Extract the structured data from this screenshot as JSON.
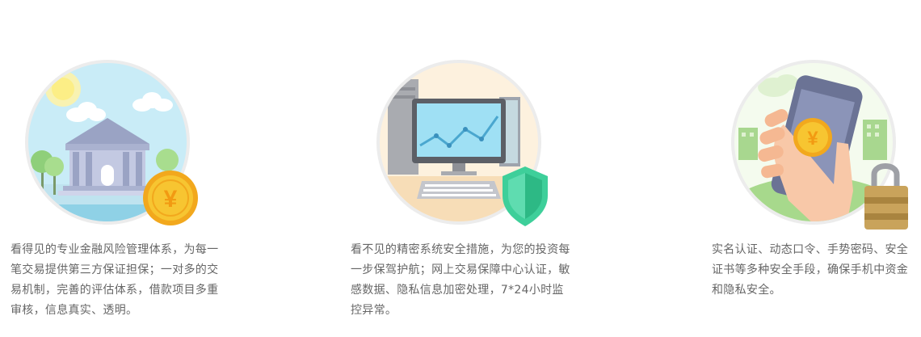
{
  "features": [
    {
      "icon": "bank-building-icon",
      "coin_symbol": "¥",
      "description": "看得见的专业金融风险管理体系，为每一笔交易提供第三方保证担保；一对多的交易机制，完善的评估体系，借款项目多重审核，信息真实、透明。"
    },
    {
      "icon": "computer-shield-icon",
      "description": "看不见的精密系统安全措施，为您的投资每一步保驾护航；网上交易保障中心认证，敏感数据、隐私信息加密处理，7*24小时监控异常。"
    },
    {
      "icon": "phone-lock-icon",
      "coin_symbol": "¥",
      "description": "实名认证、动态口令、手势密码、安全证书等多种安全手段，确保手机中资金和隐私安全。"
    }
  ],
  "colors": {
    "text": "#666666",
    "circle_border": "#eeeeee",
    "coin_gold": "#f7c531",
    "shield_green": "#3ecf9a",
    "screen_blue": "#9fe0f4"
  }
}
